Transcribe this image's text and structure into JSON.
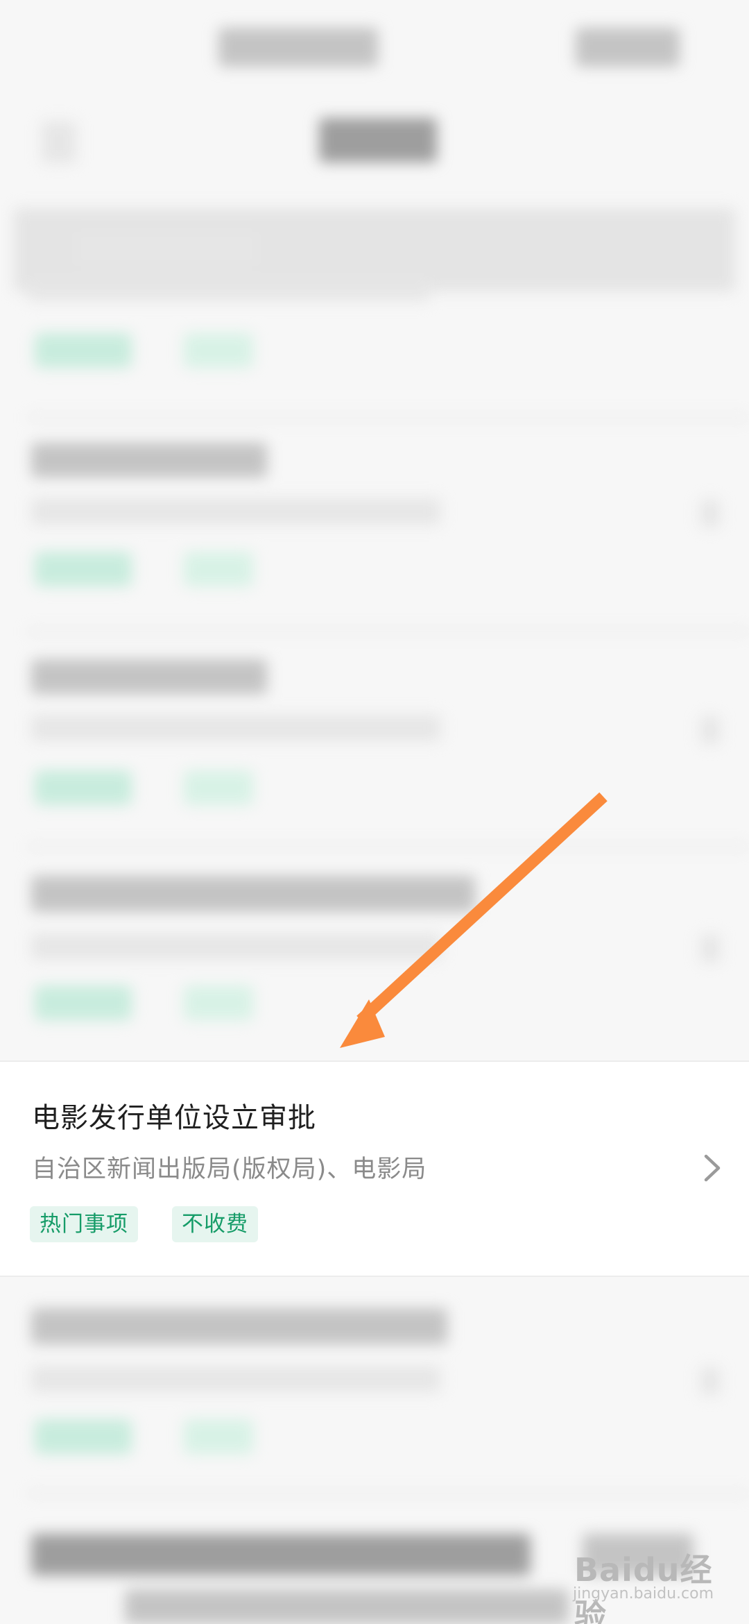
{
  "featured_item": {
    "title": "电影发行单位设立审批",
    "department": "自治区新闻出版局(版权局)、电影局",
    "tags": [
      "热门事项",
      "不收费"
    ]
  },
  "colors": {
    "accent_green": "#169c68",
    "tag_background": "#e6f5ef",
    "annotation_arrow": "#fa8a3c"
  },
  "icons": {
    "chevron": "chevron-right-icon",
    "arrow": "annotation-arrow-icon"
  },
  "watermark": {
    "logo_text": "Baidu经验",
    "domain": "jingyan.baidu.com"
  }
}
